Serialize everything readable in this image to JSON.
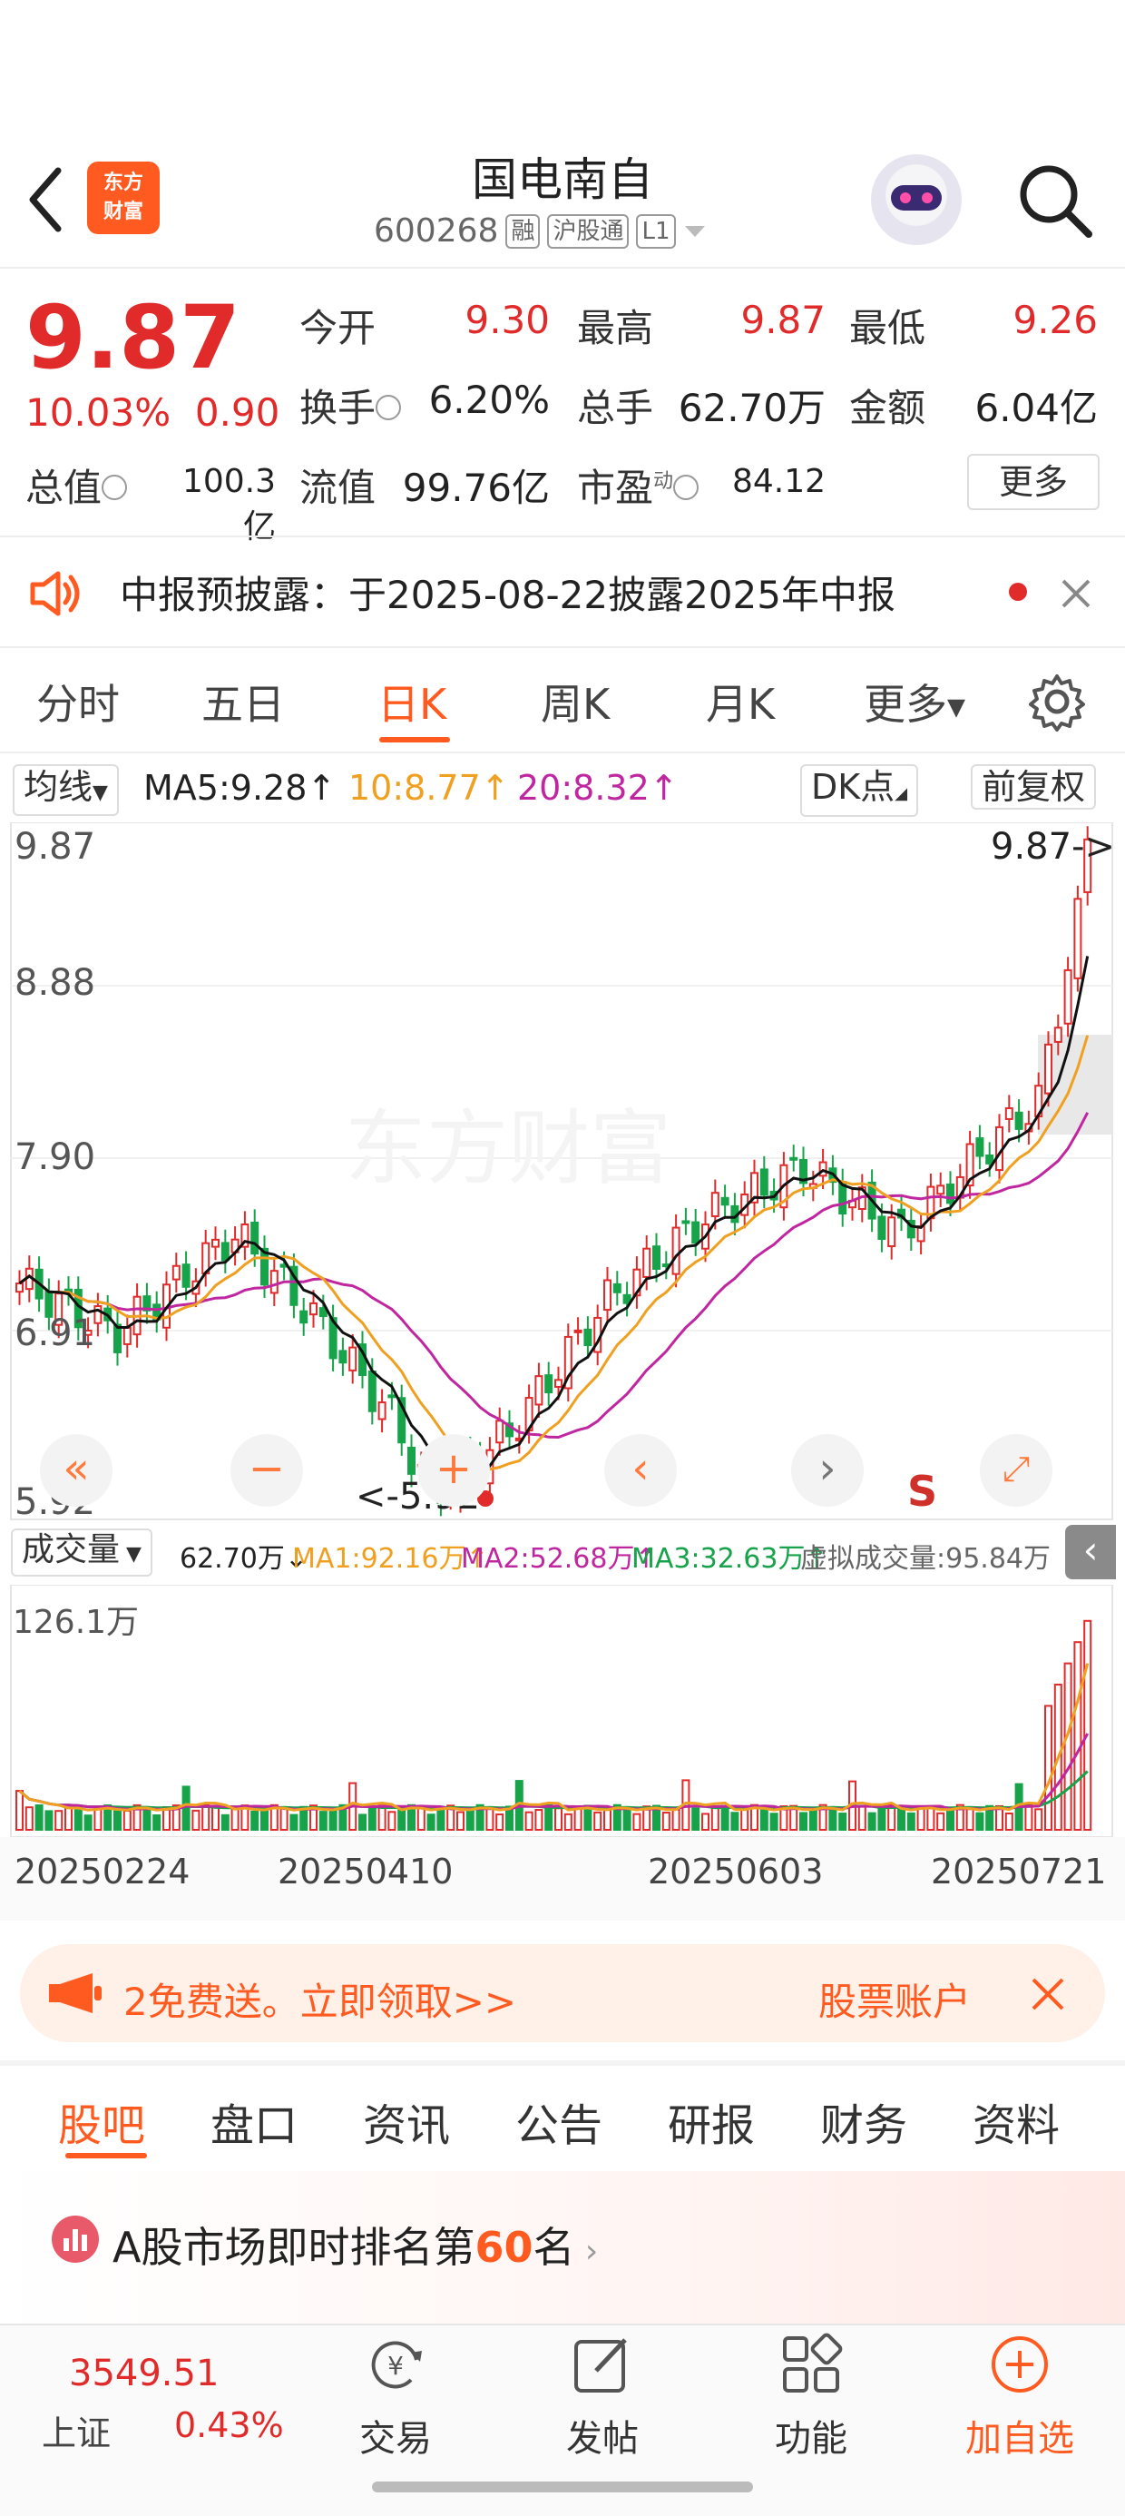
{
  "header": {
    "logo_line1": "东方",
    "logo_line2": "财富",
    "stock_name": "国电南自",
    "code": "600268",
    "tags": [
      "融",
      "沪股通",
      "L1"
    ]
  },
  "quote": {
    "price": "9.87",
    "change_pct": "10.03%",
    "change_abs": "0.90",
    "open_label": "今开",
    "open": "9.30",
    "high_label": "最高",
    "high": "9.87",
    "low_label": "最低",
    "low": "9.26",
    "turnover_label": "换手",
    "turnover": "6.20%",
    "volume_label": "总手",
    "volume": "62.70万",
    "amount_label": "金额",
    "amount": "6.04亿",
    "mktcap_label": "总值",
    "mktcap": "100.3亿",
    "float_label": "流值",
    "float_cap": "99.76亿",
    "pe_label": "市盈",
    "pe_sup": "动",
    "pe": "84.12",
    "more_button": "更多"
  },
  "notice": {
    "text": "中报预披露：于2025-08-22披露2025年中报"
  },
  "period_tabs": [
    "分时",
    "五日",
    "日K",
    "周K",
    "月K",
    "更多"
  ],
  "active_period": "日K",
  "ma_bar": {
    "mode": "均线",
    "ma5": "MA5:9.28↑",
    "ma10": "10:8.77↑",
    "ma20": "20:8.32↑",
    "dk": "DK点",
    "adjust": "前复权"
  },
  "colors": {
    "up": "#e12a2a",
    "down": "#16a34a",
    "ma5": "#111111",
    "ma10": "#f0a020",
    "ma20": "#c026a0",
    "accent": "#ff5a1f"
  },
  "kline": {
    "y_labels": [
      "9.87",
      "8.88",
      "7.90",
      "6.91",
      "5.92"
    ],
    "high_marker": "9.87->",
    "low_marker": "<-5.92",
    "watermark": "东方财富",
    "s_marker": "S"
  },
  "volume_bar": {
    "mode": "成交量",
    "vol": "62.70万↓",
    "ma1": "MA1:92.16万↑",
    "ma2": "MA2:52.68万↑",
    "ma3": "MA3:32.63万↑",
    "virtual": "虚拟成交量:95.84万",
    "max_label": "126.1万"
  },
  "x_dates": [
    "20250224",
    "20250410",
    "20250603",
    "20250721"
  ],
  "banner": {
    "left": "2免费送。立即领取>>",
    "right": "股票账户"
  },
  "content_tabs": [
    "股吧",
    "盘口",
    "资讯",
    "公告",
    "研报",
    "财务",
    "资料"
  ],
  "rank": {
    "prefix": "A股市场即时排名第",
    "num": "60",
    "suffix": "名"
  },
  "bottom": {
    "index_value": "3549.51",
    "index_name": "上证",
    "index_change": "0.43%",
    "nav": [
      "交易",
      "发帖",
      "功能",
      "加自选"
    ]
  }
}
